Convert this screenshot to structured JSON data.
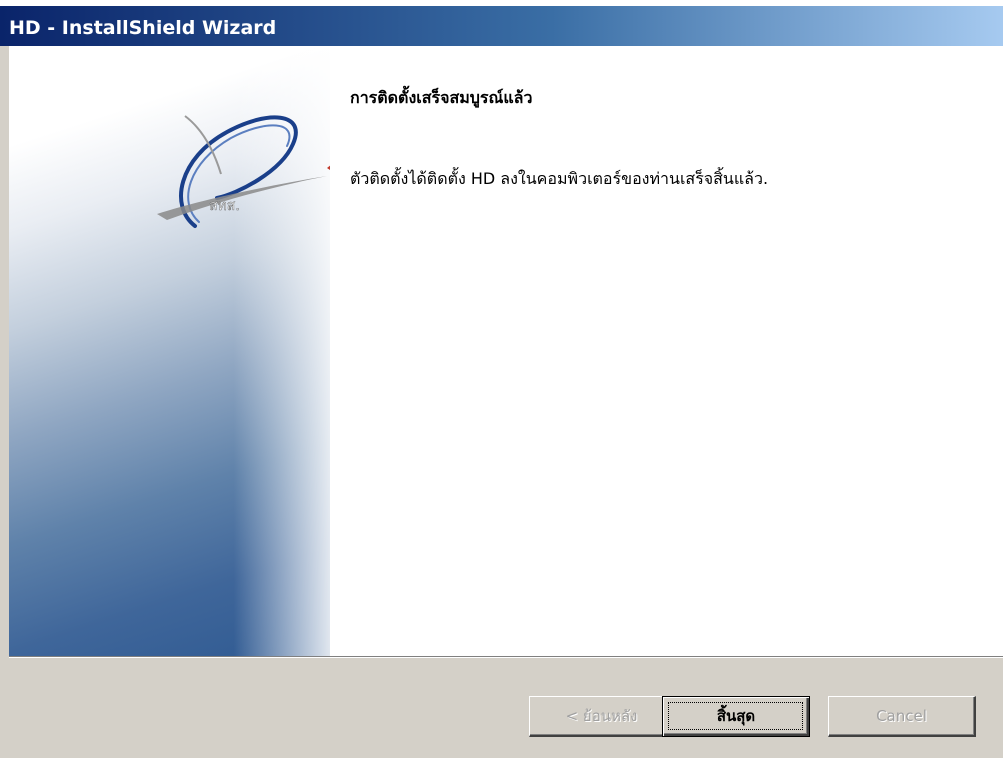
{
  "window": {
    "title": "HD - InstallShield Wizard"
  },
  "main": {
    "heading": "การติดตั้งเสร็จสมบูรณ์แล้ว",
    "message": "ตัวติดตั้งได้ติดตั้ง HD ลงในคอมพิวเตอร์ของท่านเสร็จสิ้นแล้ว."
  },
  "logo": {
    "text": "สทส."
  },
  "buttons": {
    "back_label": "< ย้อนหลัง",
    "finish_label": "สิ้นสุด",
    "cancel_label": "Cancel"
  },
  "colors": {
    "titlebar_start": "#0a246a",
    "titlebar_end": "#a6caf0",
    "panel_blue": "#2f5a92",
    "dialog_face": "#d4d0c8",
    "logo_swoosh_red": "#c0392b"
  },
  "icons": {
    "logo": "stg-swoosh-logo"
  }
}
